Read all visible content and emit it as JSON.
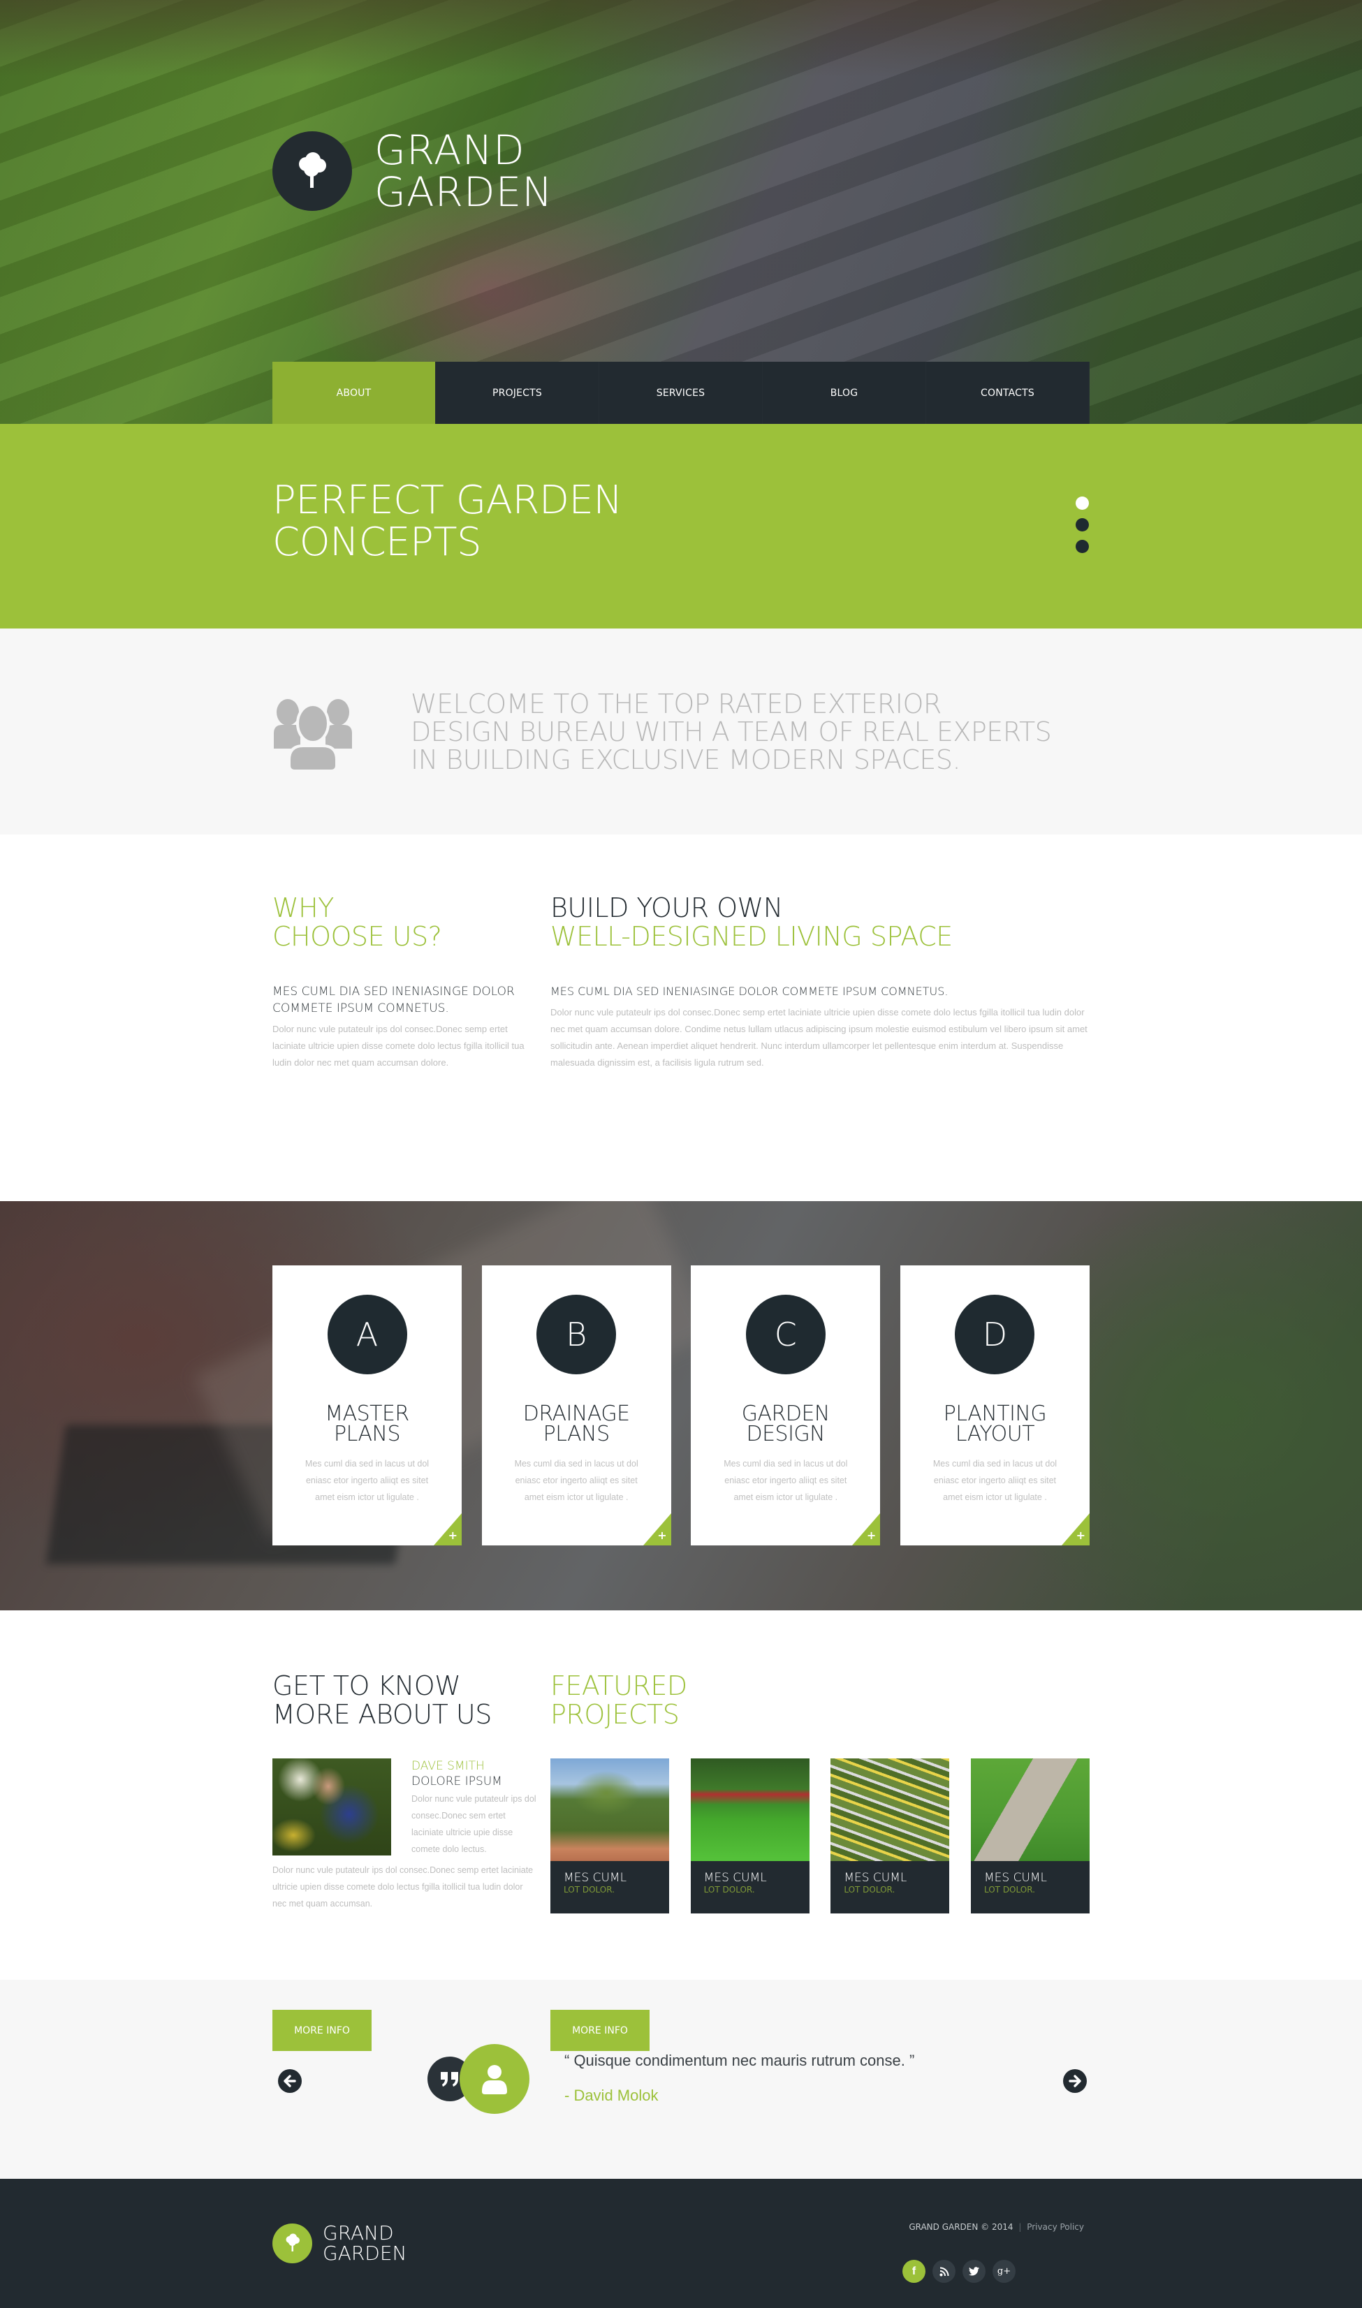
{
  "brand": {
    "line1": "GRAND",
    "line2": "GARDEN",
    "logo_icon": "tree-icon"
  },
  "nav": {
    "items": [
      {
        "label": "ABOUT",
        "active": true
      },
      {
        "label": "PROJECTS",
        "active": false
      },
      {
        "label": "SERVICES",
        "active": false
      },
      {
        "label": "BLOG",
        "active": false
      },
      {
        "label": "CONTACTS",
        "active": false
      }
    ]
  },
  "slider": {
    "title_line1": "PERFECT GARDEN",
    "title_line2": "CONCEPTS",
    "dots": 3,
    "active_dot": 1
  },
  "welcome": {
    "icon": "team-icon",
    "lines": [
      "WELCOME TO THE TOP RATED EXTERIOR",
      "DESIGN BUREAU WITH A TEAM OF REAL EXPERTS",
      "IN BUILDING EXCLUSIVE MODERN SPACES."
    ]
  },
  "why": {
    "title_line1": "WHY",
    "title_line2": "CHOOSE US?",
    "subtitle": "MES CUML DIA SED INENIASINGE DOLOR COMMETE IPSUM COMNETUS.",
    "body": "Dolor nunc vule putateulr ips dol consec.Donec semp ertet laciniate ultricie upien disse comete dolo lectus fgilla itollicil tua ludin dolor nec met quam accumsan dolore.",
    "button": "MORE INFO"
  },
  "build": {
    "title_line1": "BUILD YOUR OWN",
    "title_line2": "WELL-DESIGNED LIVING SPACE",
    "subtitle": "MES CUML DIA SED INENIASINGE DOLOR COMMETE IPSUM COMNETUS.",
    "body": "Dolor nunc vule putateulr ips dol consec.Donec semp ertet laciniate ultricie upien disse comete dolo lectus fgilla itollicil tua ludin dolor nec met quam accumsan dolore. Condime netus lullam utlacus adipiscing ipsum molestie euismod estibulum vel libero ipsum sit amet sollicitudin ante. Aenean imperdiet aliquet hendrerit. Nunc interdum ullamcorper let pellentesque enim interdum at. Suspendisse malesuada dignissim est, a facilisis ligula rutrum sed.",
    "button": "MORE INFO"
  },
  "services": [
    {
      "letter": "A",
      "title_line1": "MASTER",
      "title_line2": "PLANS",
      "body": "Mes cuml dia sed in lacus ut dol eniasc etor ingerto aliiqt es sitet amet eism ictor ut ligulate ."
    },
    {
      "letter": "B",
      "title_line1": "DRAINAGE",
      "title_line2": "PLANS",
      "body": "Mes cuml dia sed in lacus ut dol eniasc etor ingerto aliiqt es sitet amet eism ictor ut ligulate ."
    },
    {
      "letter": "C",
      "title_line1": "GARDEN",
      "title_line2": "DESIGN",
      "body": "Mes cuml dia sed in lacus ut dol eniasc etor ingerto aliiqt es sitet amet eism ictor ut ligulate ."
    },
    {
      "letter": "D",
      "title_line1": "PLANTING",
      "title_line2": "LAYOUT",
      "body": "Mes cuml dia sed in lacus ut dol eniasc etor ingerto aliiqt es sitet amet eism ictor ut ligulate ."
    }
  ],
  "service_more_symbol": "+",
  "about": {
    "title_line1": "GET TO KNOW",
    "title_line2": "MORE ABOUT US",
    "person_name": "DAVE SMITH",
    "person_role": "DOLORE IPSUM",
    "person_bio": "Dolor nunc vule putateulr ips dol consec.Donec sem ertet laciniate ultricie upie disse comete dolo lectus.",
    "body": "Dolor nunc vule putateulr ips dol consec.Donec semp ertet laciniate ultricie upien disse comete dolo lectus fgilla itollicil tua ludin dolor nec met quam accumsan."
  },
  "featured": {
    "title_line1": "FEATURED",
    "title_line2": "PROJECTS",
    "items": [
      {
        "title": "MES CUML",
        "subtitle": "LOT DOLOR."
      },
      {
        "title": "MES CUML",
        "subtitle": "LOT DOLOR."
      },
      {
        "title": "MES CUML",
        "subtitle": "LOT DOLOR."
      },
      {
        "title": "MES CUML",
        "subtitle": "LOT DOLOR."
      }
    ]
  },
  "testimonial": {
    "quote": "“ Quisque condimentum nec mauris rutrum conse. ”",
    "author": "- David Molok",
    "prev_icon": "arrow-left-circle-icon",
    "next_icon": "arrow-right-circle-icon"
  },
  "footer": {
    "brand_line1": "GRAND",
    "brand_line2": "GARDEN",
    "copyright": "GRAND GARDEN © 2014",
    "separator": "|",
    "privacy": "Privacy Policy",
    "socials": [
      {
        "name": "facebook",
        "glyph": "f"
      },
      {
        "name": "rss",
        "glyph": "rss"
      },
      {
        "name": "twitter",
        "glyph": "t"
      },
      {
        "name": "google-plus",
        "glyph": "g+"
      }
    ]
  },
  "colors": {
    "accent": "#9cc13a",
    "dark": "#222a30",
    "light_bg": "#f7f7f7"
  }
}
